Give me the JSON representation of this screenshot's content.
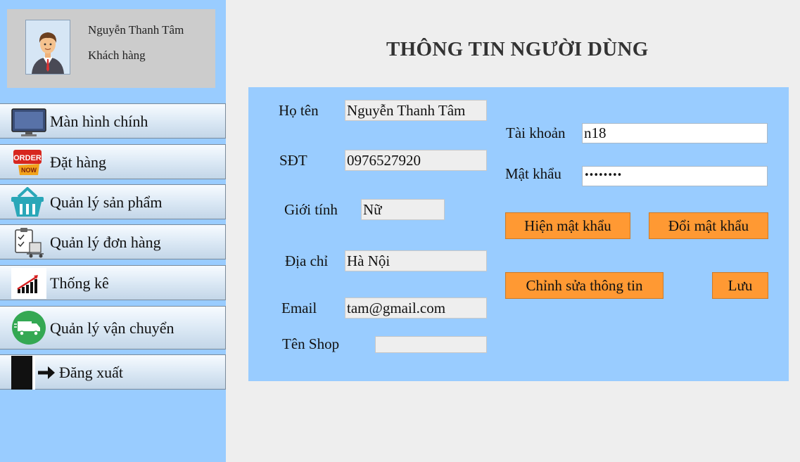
{
  "profile": {
    "name": "Nguyễn Thanh Tâm",
    "role": "Khách hàng",
    "avatar_icon": "user-avatar-icon"
  },
  "sidebar": {
    "items": [
      {
        "label": "Màn hình chính",
        "icon": "monitor-icon"
      },
      {
        "label": "Đặt hàng",
        "icon": "order-now-icon"
      },
      {
        "label": "Quản lý sản phẩm",
        "icon": "basket-icon"
      },
      {
        "label": "Quản lý đơn hàng",
        "icon": "clipboard-icon"
      },
      {
        "label": "Thống kê",
        "icon": "bar-chart-icon"
      },
      {
        "label": "Quản lý vận chuyển",
        "icon": "truck-icon"
      },
      {
        "label": "Đăng xuất",
        "icon": "logout-icon"
      }
    ]
  },
  "page": {
    "title": "THÔNG TIN NGƯỜI DÙNG"
  },
  "form": {
    "fullname_label": "Họ tên",
    "fullname_value": "Nguyễn Thanh Tâm",
    "phone_label": "SĐT",
    "phone_value": "0976527920",
    "gender_label": "Giới tính",
    "gender_value": "Nữ",
    "address_label": "Địa chỉ",
    "address_value": "Hà Nội",
    "email_label": "Email",
    "email_value": "tam@gmail.com",
    "shop_label": "Tên Shop",
    "shop_value": "",
    "account_label": "Tài khoản",
    "account_value": "n18",
    "password_label": "Mật khẩu",
    "password_value": "••••••••"
  },
  "buttons": {
    "show_password": "Hiện mật khẩu",
    "change_password": "Đổi mật khẩu",
    "edit_info": "Chỉnh sửa thông tin",
    "save": "Lưu"
  },
  "colors": {
    "sidebar_bg": "#99ccff",
    "panel_bg": "#99ccff",
    "button_bg": "#ff9933",
    "window_bg": "#eeeeee"
  }
}
